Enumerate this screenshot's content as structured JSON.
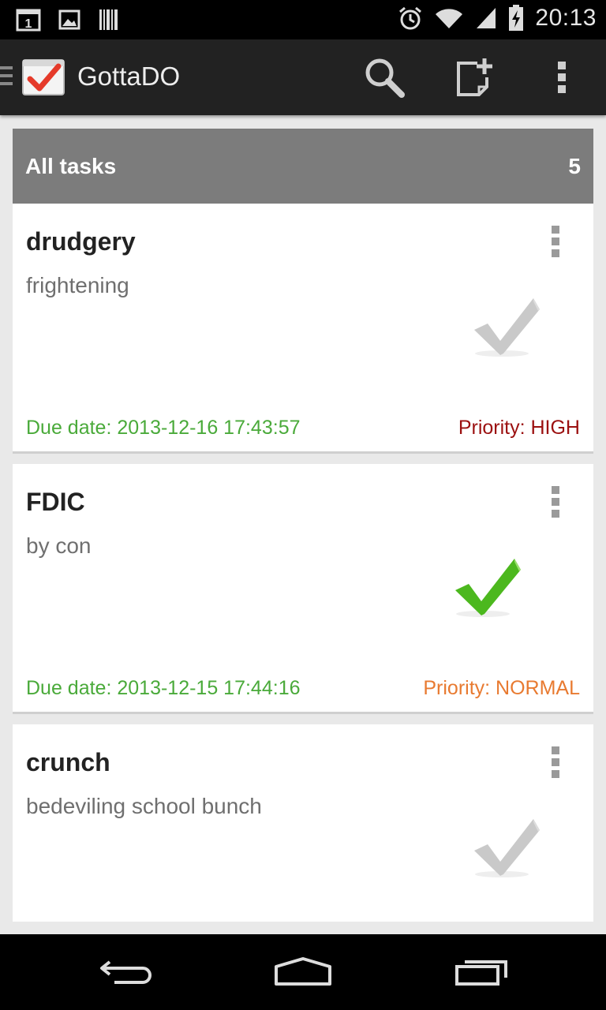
{
  "status_bar": {
    "time": "20:13",
    "notification_badge": "1",
    "icons": [
      "calendar-notification-icon",
      "image-icon",
      "barcode-icon",
      "alarm-icon",
      "wifi-icon",
      "signal-icon",
      "battery-icon"
    ]
  },
  "action_bar": {
    "title": "GottaDO",
    "icons": [
      "drawer-indicator-icon",
      "app-logo-icon",
      "search-icon",
      "add-task-icon",
      "overflow-menu-icon"
    ]
  },
  "list_header": {
    "label": "All tasks",
    "count": "5"
  },
  "tasks": [
    {
      "title": "drudgery",
      "description": "frightening",
      "due": "Due date: 2013-12-16 17:43:57",
      "priority": "Priority: HIGH",
      "priority_color": "#9b1010",
      "completed": false
    },
    {
      "title": "FDIC",
      "description": "by con",
      "due": "Due date: 2013-12-15 17:44:16",
      "priority": "Priority: NORMAL",
      "priority_color": "#e87a30",
      "completed": true
    },
    {
      "title": "crunch",
      "description": "bedeviling school bunch",
      "completed": false
    }
  ],
  "colors": {
    "due_date": "#4aaa3a",
    "check_done": "#4cb81e",
    "check_pending": "#c9c9c9",
    "header_bg": "#7c7c7c"
  },
  "nav_bar": {
    "icons": [
      "back-icon",
      "home-icon",
      "recent-apps-icon"
    ]
  }
}
